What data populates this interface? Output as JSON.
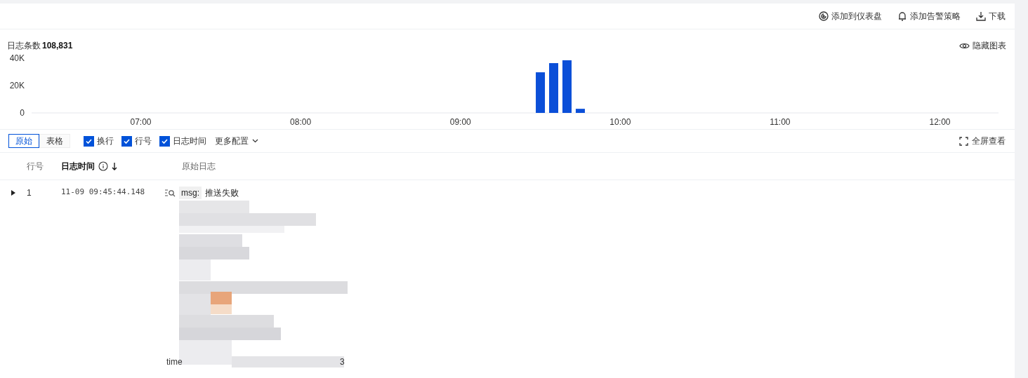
{
  "actions": [
    {
      "kind": "dashboard",
      "label": "添加到仪表盘"
    },
    {
      "kind": "alarm",
      "label": "添加告警策略"
    },
    {
      "kind": "download",
      "label": "下载"
    }
  ],
  "summary": {
    "label": "日志条数",
    "count": "108,831"
  },
  "hide_chart": {
    "label": "隐藏图表"
  },
  "chart_data": {
    "type": "bar",
    "x": [
      570,
      575,
      580,
      585
    ],
    "series": [
      {
        "color": "#0b4fd8",
        "values": [
          29700,
          36400,
          38500,
          3000
        ]
      }
    ],
    "xlim": [
      379,
      742
    ],
    "ylim": [
      0,
      40000
    ],
    "xticks": [
      {
        "value": 420,
        "label": "07:00"
      },
      {
        "value": 480,
        "label": "08:00"
      },
      {
        "value": 540,
        "label": "09:00"
      },
      {
        "value": 600,
        "label": "10:00"
      },
      {
        "value": 660,
        "label": "11:00"
      },
      {
        "value": 720,
        "label": "12:00"
      }
    ],
    "yticks": [
      {
        "value": 0,
        "label": "0"
      },
      {
        "value": 20000,
        "label": "20K"
      },
      {
        "value": 40000,
        "label": "40K"
      }
    ]
  },
  "view_tabs": [
    {
      "label": "原始",
      "selected": true
    },
    {
      "label": "表格",
      "selected": false
    }
  ],
  "options": [
    {
      "label": "换行",
      "checked": true
    },
    {
      "label": "行号",
      "checked": true
    },
    {
      "label": "日志时间",
      "checked": true
    }
  ],
  "more_config": "更多配置",
  "fullscreen": "全屏查看",
  "columns": [
    {
      "label": "行号",
      "sortable": false
    },
    {
      "label": "日志时间",
      "sortable": true
    },
    {
      "label": "原始日志",
      "sortable": false
    }
  ],
  "rows": [
    {
      "index": "1",
      "expanded": false,
      "time": "11-09 09:45:44.148",
      "key": "msg:",
      "value": "推送失败",
      "tail_start": "time",
      "tail_end": "3"
    }
  ]
}
